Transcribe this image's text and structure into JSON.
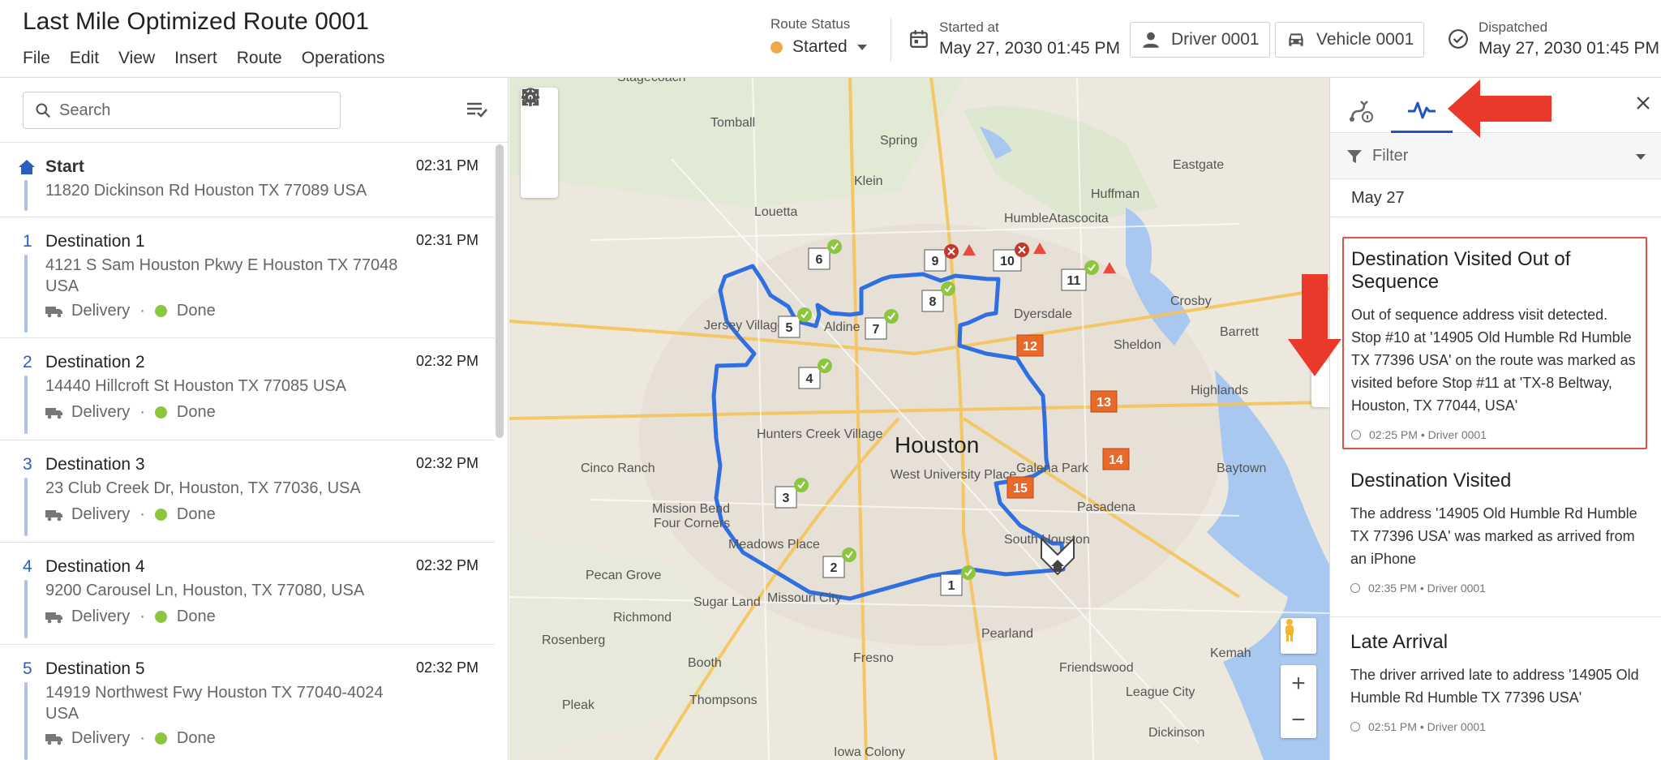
{
  "header": {
    "title": "Last Mile Optimized Route 0001",
    "menu": [
      "File",
      "Edit",
      "View",
      "Insert",
      "Route",
      "Operations"
    ],
    "route_status_caption": "Route Status",
    "route_status_value": "Started",
    "route_status_color": "#f0a84a",
    "started_caption": "Started at",
    "started_value": "May 27, 2030 01:45 PM",
    "driver": "Driver 0001",
    "vehicle": "Vehicle 0001",
    "dispatched_caption": "Dispatched",
    "dispatched_value": "May 27, 2030 01:45 PM"
  },
  "search": {
    "placeholder": "Search"
  },
  "stops": [
    {
      "num": "",
      "name": "Start",
      "time": "02:31 PM",
      "address": "11820 Dickinson Rd Houston TX 77089 USA"
    },
    {
      "num": "1",
      "name": "Destination 1",
      "time": "02:31 PM",
      "address": "4121 S Sam Houston Pkwy E Houston TX 77048 USA",
      "type": "Delivery",
      "status": "Done"
    },
    {
      "num": "2",
      "name": "Destination 2",
      "time": "02:32 PM",
      "address": "14440 Hillcroft St Houston TX 77085 USA",
      "type": "Delivery",
      "status": "Done"
    },
    {
      "num": "3",
      "name": "Destination 3",
      "time": "02:32 PM",
      "address": "23 Club Creek Dr, Houston, TX 77036, USA",
      "type": "Delivery",
      "status": "Done"
    },
    {
      "num": "4",
      "name": "Destination 4",
      "time": "02:32 PM",
      "address": "9200 Carousel Ln, Houston, TX 77080, USA",
      "type": "Delivery",
      "status": "Done"
    },
    {
      "num": "5",
      "name": "Destination 5",
      "time": "02:32 PM",
      "address": "14919 Northwest Fwy Houston TX 77040-4024 USA",
      "type": "Delivery",
      "status": "Done"
    }
  ],
  "map": {
    "city_label": "Houston",
    "places": [
      "Stagecoach",
      "Tomball",
      "Spring",
      "Klein",
      "Humble",
      "Eastgate",
      "Huffman",
      "Louetta",
      "Atascocita",
      "Crosby",
      "Jersey Village",
      "Aldine",
      "Dyersdale",
      "Sheldon",
      "Barrett",
      "Highlands",
      "Hunters Creek Village",
      "West University Place",
      "Galena Park",
      "Cinco Ranch",
      "Mission Bend",
      "Four Corners",
      "Meadows Place",
      "Pasadena",
      "Baytown",
      "South Houston",
      "Pecan Grove",
      "Sugar Land",
      "Missouri City",
      "Richmond",
      "Rosenberg",
      "Pearland",
      "Friendswood",
      "Kemah",
      "Booth",
      "Fresno",
      "League City",
      "Pleak",
      "Thompsons",
      "Dickinson",
      "Iowa Colony"
    ],
    "markers": [
      "1",
      "2",
      "3",
      "4",
      "5",
      "6",
      "7",
      "8",
      "9",
      "10",
      "11",
      "12",
      "13",
      "14",
      "15"
    ],
    "route_color": "#2f6fe0",
    "done_color": "#8cc63f",
    "pending_marker_color": "#e8692a"
  },
  "panel": {
    "filter_label": "Filter",
    "date_label": "May 27",
    "events": [
      {
        "title": "Destination Visited Out of Sequence",
        "body": "Out of sequence address visit detected. Stop #10 at '14905 Old Humble Rd Humble TX 77396 USA' on the route was marked as visited before Stop #11 at 'TX-8 Beltway, Houston, TX 77044, USA'",
        "meta": "02:25 PM • Driver 0001"
      },
      {
        "title": "Destination Visited",
        "body": "The address '14905 Old Humble Rd Humble TX 77396 USA' was marked as arrived from an iPhone",
        "meta": "02:35 PM • Driver 0001"
      },
      {
        "title": "Late Arrival",
        "body": "The driver arrived late to address '14905 Old Humble Rd Humble TX 77396 USA'",
        "meta": "02:51 PM • Driver 0001"
      }
    ]
  },
  "colors": {
    "accent": "#1f56c6",
    "annotation": "#e8392b"
  }
}
